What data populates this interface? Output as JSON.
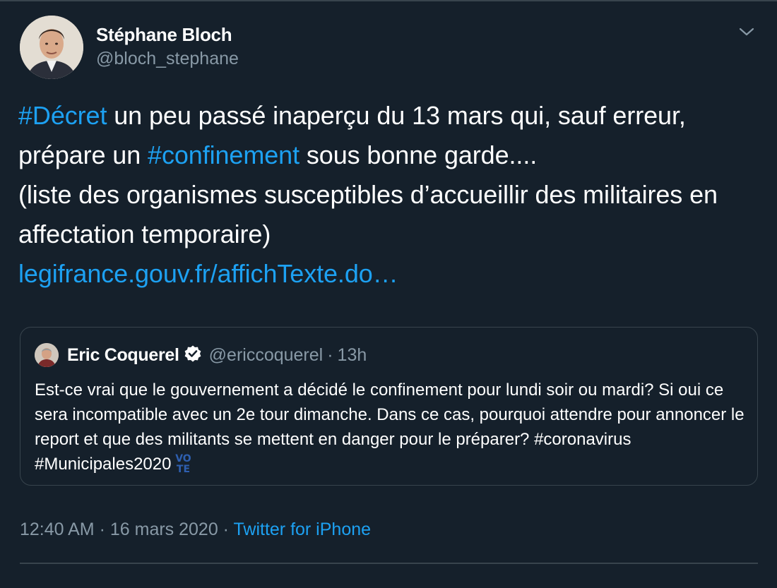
{
  "author": {
    "name": "Stéphane Bloch",
    "handle": "@bloch_stephane"
  },
  "tweet": {
    "hashtag1": "#Décret",
    "text1": " un peu passé inaperçu du 13 mars qui, sauf erreur, prépare un ",
    "hashtag2": "#confinement",
    "text2": " sous bonne garde....",
    "text3": "(liste des organismes susceptibles d’accueillir des militaires en affectation temporaire)",
    "link": "legifrance.gouv.fr/affichTexte.do…"
  },
  "quoted": {
    "name": "Eric Coquerel",
    "handle": "@ericcoquerel",
    "separator": "·",
    "time": "13h",
    "text": "Est-ce vrai que le gouvernement a décidé le confinement pour lundi soir ou mardi? Si oui ce sera incompatible avec un 2e tour dimanche. Dans ce cas, pourquoi attendre pour annoncer le report et que des militants se mettent en danger pour le préparer? ",
    "hashtag1": "#coronavirus",
    "hashtag2": "#Municipales2020",
    "emoji_top": "VO",
    "emoji_bottom": "TE"
  },
  "footer": {
    "time": "12:40 AM",
    "separator1": " · ",
    "date": "16 mars 2020",
    "separator2": " · ",
    "source": "Twitter for iPhone"
  },
  "colors": {
    "background": "#15202b",
    "link": "#1da1f2",
    "muted": "#8899a6",
    "border": "#38444d"
  },
  "icons": {
    "menu": "chevron-down-icon",
    "verified": "verified-badge-icon"
  }
}
